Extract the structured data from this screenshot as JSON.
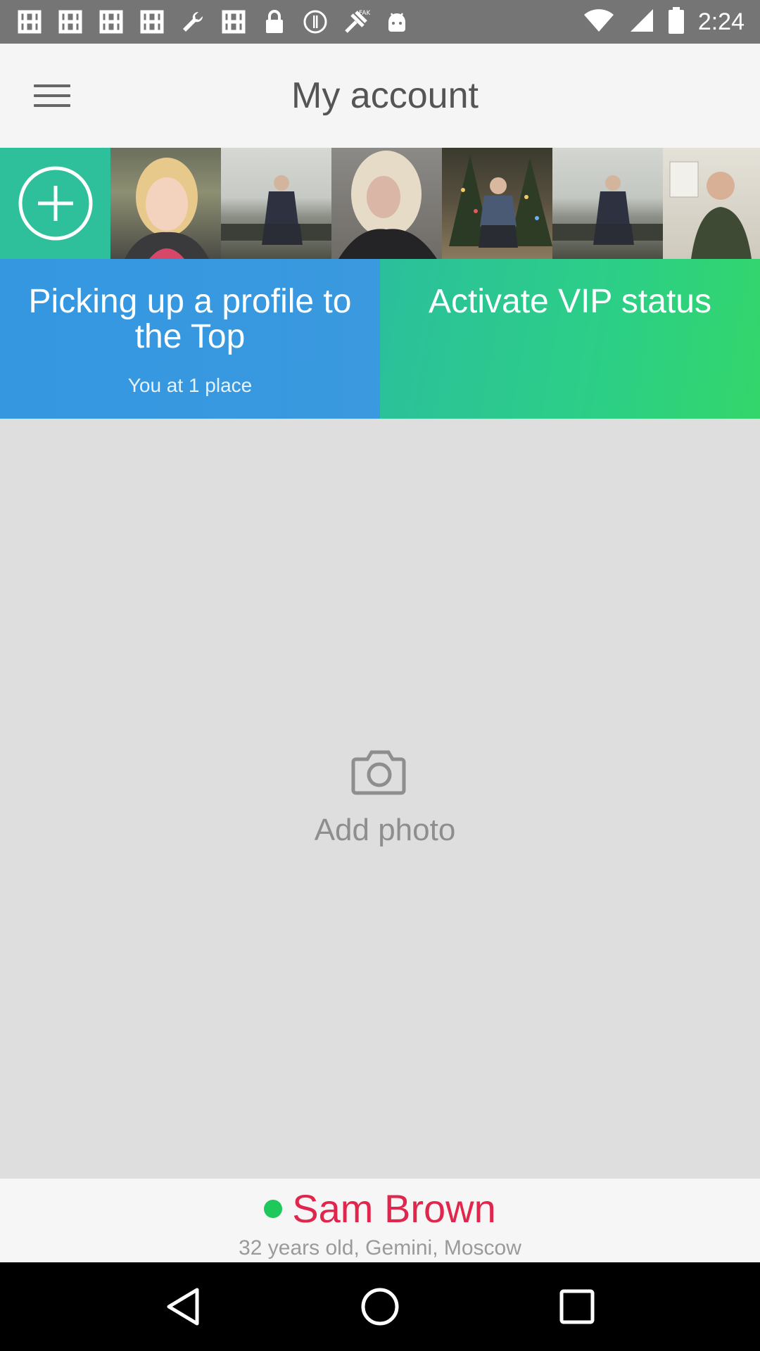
{
  "status_bar": {
    "time": "2:24",
    "icons": [
      "notification-icon",
      "notification-icon",
      "notification-icon",
      "notification-icon",
      "wrench-icon",
      "notification-icon",
      "lock-icon",
      "alert-icon",
      "fake-gps-icon",
      "android-icon",
      "wifi-icon",
      "signal-icon",
      "battery-icon"
    ]
  },
  "app_bar": {
    "title": "My account",
    "menu_icon": "menu-icon"
  },
  "photo_strip": {
    "add_icon": "add-circle-icon",
    "thumbnails": [
      {
        "name": "thumb-woman-blonde-1"
      },
      {
        "name": "thumb-man-seaside-1"
      },
      {
        "name": "thumb-woman-blonde-2"
      },
      {
        "name": "thumb-man-christmas-tree"
      },
      {
        "name": "thumb-man-seaside-2"
      },
      {
        "name": "thumb-man-office"
      }
    ]
  },
  "promos": {
    "top": {
      "title": "Picking up a profile to the Top",
      "subtitle": "You at 1 place"
    },
    "vip": {
      "title": "Activate VIP status"
    }
  },
  "photo_area": {
    "icon": "camera-icon",
    "label": "Add photo"
  },
  "profile": {
    "online": true,
    "name": "Sam Brown",
    "details": "32 years old, Gemini, Moscow"
  },
  "colors": {
    "add_tile": "#2ec09a",
    "top_promo": "#3497e0",
    "vip_promo": "#2ccf86",
    "name": "#e0264c",
    "online_dot": "#1ec85a"
  },
  "nav_bar": {
    "back_icon": "back-icon",
    "home_icon": "home-icon",
    "recents_icon": "recents-icon"
  }
}
